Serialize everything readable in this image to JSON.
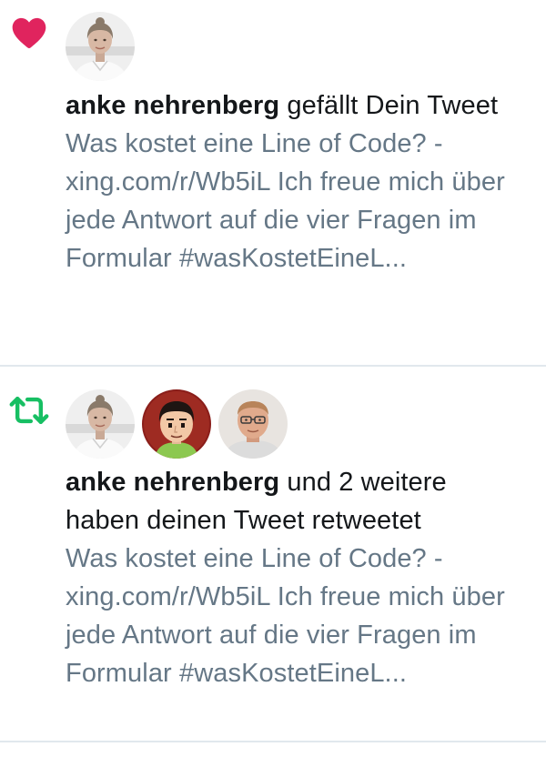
{
  "colors": {
    "like_heart": "#e0245e",
    "retweet": "#17bf63",
    "primary_text": "#14171a",
    "secondary_text": "#657786",
    "divider": "#e1e8ed"
  },
  "notifications": [
    {
      "type": "like",
      "icon": "heart-icon",
      "actor": "anke nehrenberg",
      "action": "gefällt Dein Tweet",
      "tweet": "Was kostet eine Line of Code? - xing.com/r/Wb5iL Ich freue mich über jede Antwort auf die vier Fragen im Formular #wasKostetEineL..."
    },
    {
      "type": "retweet",
      "icon": "retweet-icon",
      "actor": "anke nehrenberg",
      "action": "und 2 weitere haben deinen Tweet retweetet",
      "tweet": "Was kostet eine Line of Code? - xing.com/r/Wb5iL Ich freue mich über jede Antwort auf die vier Fragen im Formular #wasKostetEineL..."
    }
  ]
}
